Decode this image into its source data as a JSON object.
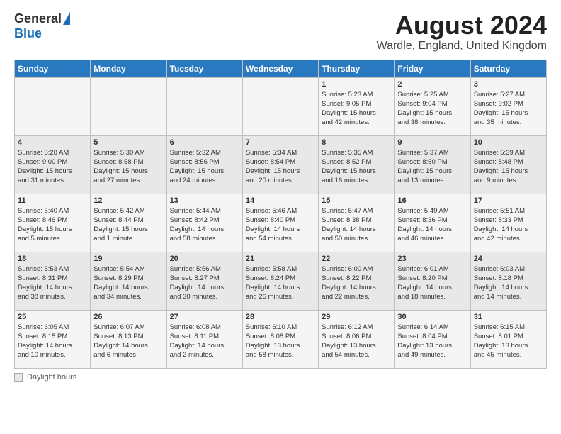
{
  "header": {
    "logo_general": "General",
    "logo_blue": "Blue",
    "month_year": "August 2024",
    "location": "Wardle, England, United Kingdom"
  },
  "days_of_week": [
    "Sunday",
    "Monday",
    "Tuesday",
    "Wednesday",
    "Thursday",
    "Friday",
    "Saturday"
  ],
  "weeks": [
    {
      "days": [
        {
          "num": "",
          "info": ""
        },
        {
          "num": "",
          "info": ""
        },
        {
          "num": "",
          "info": ""
        },
        {
          "num": "",
          "info": ""
        },
        {
          "num": "1",
          "info": "Sunrise: 5:23 AM\nSunset: 9:05 PM\nDaylight: 15 hours\nand 42 minutes."
        },
        {
          "num": "2",
          "info": "Sunrise: 5:25 AM\nSunset: 9:04 PM\nDaylight: 15 hours\nand 38 minutes."
        },
        {
          "num": "3",
          "info": "Sunrise: 5:27 AM\nSunset: 9:02 PM\nDaylight: 15 hours\nand 35 minutes."
        }
      ]
    },
    {
      "days": [
        {
          "num": "4",
          "info": "Sunrise: 5:28 AM\nSunset: 9:00 PM\nDaylight: 15 hours\nand 31 minutes."
        },
        {
          "num": "5",
          "info": "Sunrise: 5:30 AM\nSunset: 8:58 PM\nDaylight: 15 hours\nand 27 minutes."
        },
        {
          "num": "6",
          "info": "Sunrise: 5:32 AM\nSunset: 8:56 PM\nDaylight: 15 hours\nand 24 minutes."
        },
        {
          "num": "7",
          "info": "Sunrise: 5:34 AM\nSunset: 8:54 PM\nDaylight: 15 hours\nand 20 minutes."
        },
        {
          "num": "8",
          "info": "Sunrise: 5:35 AM\nSunset: 8:52 PM\nDaylight: 15 hours\nand 16 minutes."
        },
        {
          "num": "9",
          "info": "Sunrise: 5:37 AM\nSunset: 8:50 PM\nDaylight: 15 hours\nand 13 minutes."
        },
        {
          "num": "10",
          "info": "Sunrise: 5:39 AM\nSunset: 8:48 PM\nDaylight: 15 hours\nand 9 minutes."
        }
      ]
    },
    {
      "days": [
        {
          "num": "11",
          "info": "Sunrise: 5:40 AM\nSunset: 8:46 PM\nDaylight: 15 hours\nand 5 minutes."
        },
        {
          "num": "12",
          "info": "Sunrise: 5:42 AM\nSunset: 8:44 PM\nDaylight: 15 hours\nand 1 minute."
        },
        {
          "num": "13",
          "info": "Sunrise: 5:44 AM\nSunset: 8:42 PM\nDaylight: 14 hours\nand 58 minutes."
        },
        {
          "num": "14",
          "info": "Sunrise: 5:46 AM\nSunset: 8:40 PM\nDaylight: 14 hours\nand 54 minutes."
        },
        {
          "num": "15",
          "info": "Sunrise: 5:47 AM\nSunset: 8:38 PM\nDaylight: 14 hours\nand 50 minutes."
        },
        {
          "num": "16",
          "info": "Sunrise: 5:49 AM\nSunset: 8:36 PM\nDaylight: 14 hours\nand 46 minutes."
        },
        {
          "num": "17",
          "info": "Sunrise: 5:51 AM\nSunset: 8:33 PM\nDaylight: 14 hours\nand 42 minutes."
        }
      ]
    },
    {
      "days": [
        {
          "num": "18",
          "info": "Sunrise: 5:53 AM\nSunset: 8:31 PM\nDaylight: 14 hours\nand 38 minutes."
        },
        {
          "num": "19",
          "info": "Sunrise: 5:54 AM\nSunset: 8:29 PM\nDaylight: 14 hours\nand 34 minutes."
        },
        {
          "num": "20",
          "info": "Sunrise: 5:56 AM\nSunset: 8:27 PM\nDaylight: 14 hours\nand 30 minutes."
        },
        {
          "num": "21",
          "info": "Sunrise: 5:58 AM\nSunset: 8:24 PM\nDaylight: 14 hours\nand 26 minutes."
        },
        {
          "num": "22",
          "info": "Sunrise: 6:00 AM\nSunset: 8:22 PM\nDaylight: 14 hours\nand 22 minutes."
        },
        {
          "num": "23",
          "info": "Sunrise: 6:01 AM\nSunset: 8:20 PM\nDaylight: 14 hours\nand 18 minutes."
        },
        {
          "num": "24",
          "info": "Sunrise: 6:03 AM\nSunset: 8:18 PM\nDaylight: 14 hours\nand 14 minutes."
        }
      ]
    },
    {
      "days": [
        {
          "num": "25",
          "info": "Sunrise: 6:05 AM\nSunset: 8:15 PM\nDaylight: 14 hours\nand 10 minutes."
        },
        {
          "num": "26",
          "info": "Sunrise: 6:07 AM\nSunset: 8:13 PM\nDaylight: 14 hours\nand 6 minutes."
        },
        {
          "num": "27",
          "info": "Sunrise: 6:08 AM\nSunset: 8:11 PM\nDaylight: 14 hours\nand 2 minutes."
        },
        {
          "num": "28",
          "info": "Sunrise: 6:10 AM\nSunset: 8:08 PM\nDaylight: 13 hours\nand 58 minutes."
        },
        {
          "num": "29",
          "info": "Sunrise: 6:12 AM\nSunset: 8:06 PM\nDaylight: 13 hours\nand 54 minutes."
        },
        {
          "num": "30",
          "info": "Sunrise: 6:14 AM\nSunset: 8:04 PM\nDaylight: 13 hours\nand 49 minutes."
        },
        {
          "num": "31",
          "info": "Sunrise: 6:15 AM\nSunset: 8:01 PM\nDaylight: 13 hours\nand 45 minutes."
        }
      ]
    }
  ],
  "footer": {
    "label": "Daylight hours"
  }
}
